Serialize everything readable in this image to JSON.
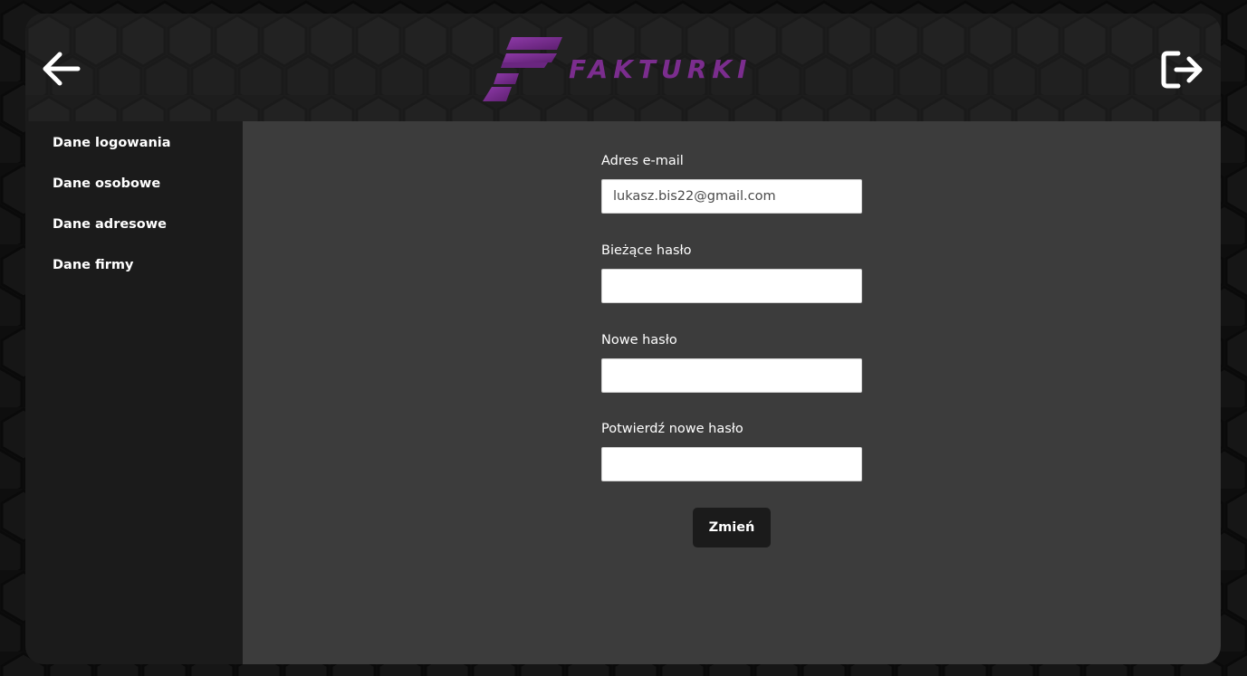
{
  "header": {
    "brand": "FAKTURKI",
    "back_icon": "arrow-left-icon",
    "logout_icon": "logout-icon",
    "brand_color": "#7b2d8e"
  },
  "sidebar": {
    "items": [
      {
        "label": "Dane logowania"
      },
      {
        "label": "Dane osobowe"
      },
      {
        "label": "Dane adresowe"
      },
      {
        "label": "Dane firmy"
      }
    ]
  },
  "form": {
    "email_label": "Adres e-mail",
    "email_value": "lukasz.bis22@gmail.com",
    "current_password_label": "Bieżące hasło",
    "current_password_value": "",
    "new_password_label": "Nowe hasło",
    "new_password_value": "",
    "confirm_password_label": "Potwierdź nowe hasło",
    "confirm_password_value": "",
    "submit_label": "Zmień"
  }
}
